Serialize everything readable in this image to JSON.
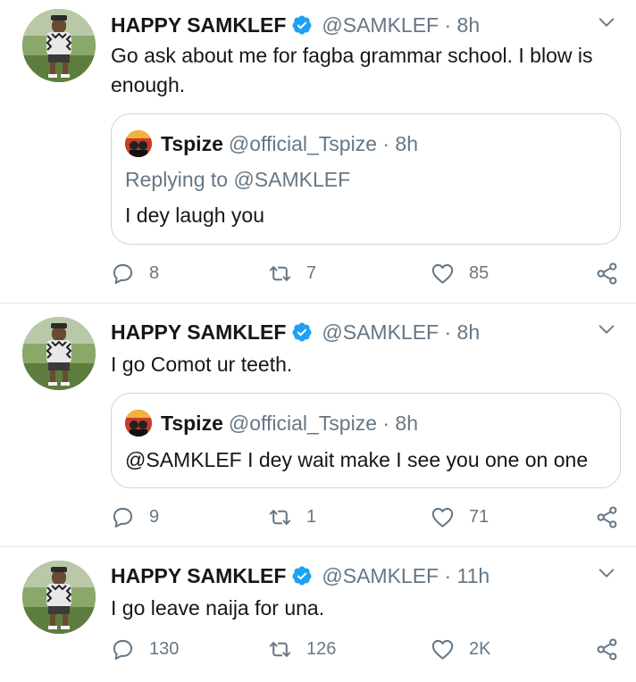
{
  "tweets": [
    {
      "name": "HAPPY SAMKLEF",
      "handle": "@SAMKLEF · 8h",
      "text": "Go ask about me for fagba grammar school. I blow is enough.",
      "quote": {
        "name": "Tspize",
        "handle": "@official_Tspize · 8h",
        "replying": "Replying to @SAMKLEF",
        "text": "I dey laugh you"
      },
      "replies": "8",
      "retweets": "7",
      "likes": "85"
    },
    {
      "name": "HAPPY SAMKLEF",
      "handle": "@SAMKLEF · 8h",
      "text": "I go Comot ur teeth.",
      "quote": {
        "name": "Tspize",
        "handle": "@official_Tspize · 8h",
        "text": "@SAMKLEF I dey wait make I see you one on one"
      },
      "replies": "9",
      "retweets": "1",
      "likes": "71"
    },
    {
      "name": "HAPPY SAMKLEF",
      "handle": "@SAMKLEF · 11h",
      "text": "I go leave naija for una.",
      "replies": "130",
      "retweets": "126",
      "likes": "2K"
    }
  ],
  "icons": {
    "verified": "verified-badge-icon",
    "chevron": "chevron-down-icon",
    "reply": "reply-icon",
    "retweet": "retweet-icon",
    "like": "heart-icon",
    "share": "share-icon"
  },
  "colors": {
    "accent": "#1da1f2",
    "secondary_text": "#657786",
    "border": "#ccd6dd"
  }
}
